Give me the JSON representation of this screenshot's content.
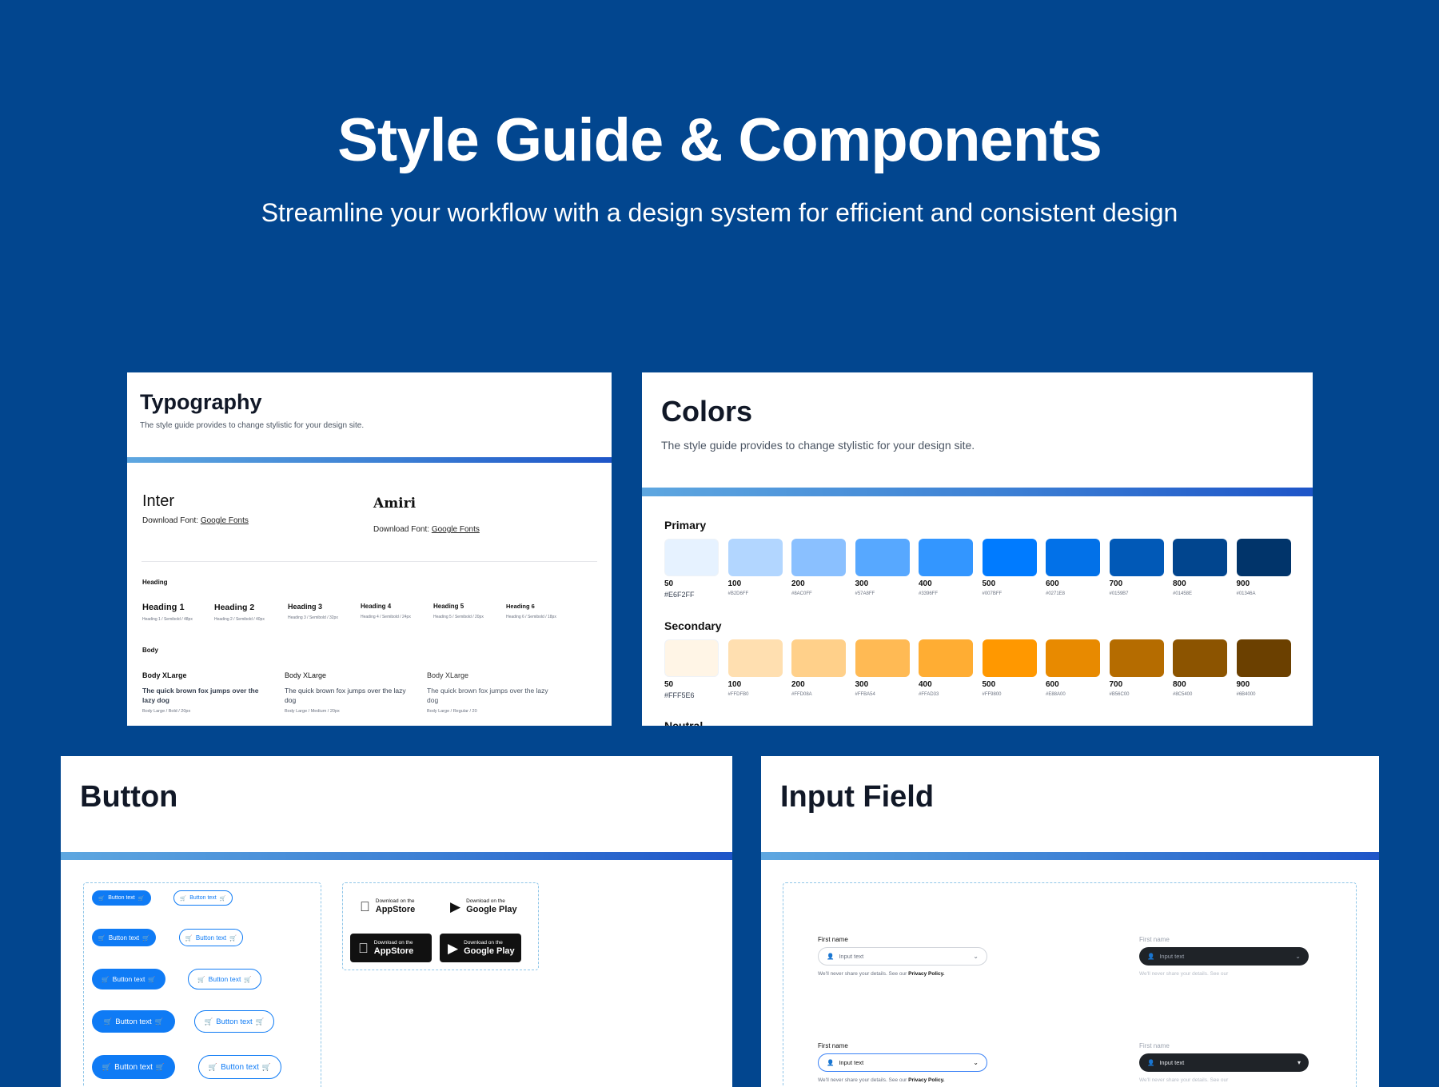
{
  "hero": {
    "title": "Style Guide & Components",
    "subtitle": "Streamline your workflow with a design system for efficient and consistent design"
  },
  "typography": {
    "title": "Typography",
    "description": "The style guide provides to change stylistic for your design site.",
    "fonts": [
      {
        "name": "Inter",
        "download_prefix": "Download Font: ",
        "download_link": "Google Fonts"
      },
      {
        "name": "Amiri",
        "download_prefix": "Download Font: ",
        "download_link": "Google Fonts"
      }
    ],
    "heading_section": "Heading",
    "headings": [
      {
        "label": "Heading 1",
        "meta": "Heading 1 / Semibold / 48px"
      },
      {
        "label": "Heading 2",
        "meta": "Heading 2 / Semibold / 40px"
      },
      {
        "label": "Heading 3",
        "meta": "Heading 3 / Semibold / 32px"
      },
      {
        "label": "Heading 4",
        "meta": "Heading 4 / Semibold / 24px"
      },
      {
        "label": "Heading 5",
        "meta": "Heading 5 / Semibold / 20px"
      },
      {
        "label": "Heading 6",
        "meta": "Heading 6 / Semibold / 18px"
      }
    ],
    "body_section": "Body",
    "bodies": [
      {
        "title": "Body XLarge",
        "text": "The quick brown fox jumps over the lazy dog",
        "meta": "Body Large / Bold / 20px"
      },
      {
        "title": "Body XLarge",
        "text": "The quick brown fox jumps over the lazy dog",
        "meta": "Body Large / Medium / 20px"
      },
      {
        "title": "Body XLarge",
        "text": "The quick brown fox jumps over the lazy dog",
        "meta": "Body Large / Regular / 20"
      }
    ]
  },
  "colors": {
    "title": "Colors",
    "description": "The style guide provides to change stylistic for your design site.",
    "primary_label": "Primary",
    "primary": [
      {
        "step": "50",
        "hex": "#E6F2FF",
        "color": "#E6F2FF"
      },
      {
        "step": "100",
        "hex": "#B2D6FF",
        "color": "#B2D6FF"
      },
      {
        "step": "200",
        "hex": "#8AC0FF",
        "color": "#8AC0FF"
      },
      {
        "step": "300",
        "hex": "#57A8FF",
        "color": "#57A8FF"
      },
      {
        "step": "400",
        "hex": "#3396FF",
        "color": "#3396FF"
      },
      {
        "step": "500",
        "hex": "#007BFF",
        "color": "#007BFF"
      },
      {
        "step": "600",
        "hex": "#0271E8",
        "color": "#0271E8"
      },
      {
        "step": "700",
        "hex": "#0159B7",
        "color": "#0159B7"
      },
      {
        "step": "800",
        "hex": "#01458E",
        "color": "#01458E"
      },
      {
        "step": "900",
        "hex": "#01346A",
        "color": "#01346A"
      }
    ],
    "secondary_label": "Secondary",
    "secondary": [
      {
        "step": "50",
        "hex": "#FFF5E6",
        "color": "#FFF5E6"
      },
      {
        "step": "100",
        "hex": "#FFDFB0",
        "color": "#FFDFB0"
      },
      {
        "step": "200",
        "hex": "#FFD08A",
        "color": "#FFD08A"
      },
      {
        "step": "300",
        "hex": "#FFBA54",
        "color": "#FFBA54"
      },
      {
        "step": "400",
        "hex": "#FFAD33",
        "color": "#FFAD33"
      },
      {
        "step": "500",
        "hex": "#FF9800",
        "color": "#FF9800"
      },
      {
        "step": "600",
        "hex": "#E88A00",
        "color": "#E88A00"
      },
      {
        "step": "700",
        "hex": "#B56C00",
        "color": "#B56C00"
      },
      {
        "step": "800",
        "hex": "#8C5400",
        "color": "#8C5400"
      },
      {
        "step": "900",
        "hex": "#6B4000",
        "color": "#6B4000"
      }
    ],
    "neutral_label": "Neutral"
  },
  "buttons": {
    "title": "Button",
    "label": "Button text",
    "cart_icon": "cart-icon",
    "stores": {
      "appstore_small": "Download on the",
      "appstore_big": "AppStore",
      "googleplay_small": "Download on the",
      "googleplay_big": "Google Play"
    }
  },
  "inputs": {
    "title": "Input Field",
    "label": "First name",
    "placeholder": "Input text",
    "help_prefix": "We'll never share your details. See our ",
    "help_link": "Privacy Policy.",
    "help_truncated": "We'll never share your details. See our"
  }
}
